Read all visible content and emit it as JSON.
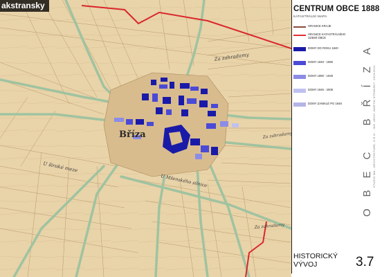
{
  "watermark": "akstransky",
  "panel": {
    "title": "CENTRUM OBCE 1888",
    "subtitle": "KATASTRÁLNÍ MAPA",
    "vertical_title": "OBEC BŘÍZA",
    "vertical_credit": "STUDIO MA - ARCHITEKTURE, S.R.O. - ING. ARCH. MARTIN STRÁNSKÝ, 2023/2024",
    "footer_label": "HISTORICKÝ\nVÝVOJ",
    "page_number": "3.7"
  },
  "legend": [
    {
      "label": "HRANICE KRAJE",
      "kind": "line",
      "color": "#8b4a3a"
    },
    {
      "label": "HRANICE KATASTRÁLNÍHO\nÚZEMÍ OBCE",
      "kind": "line",
      "color": "#e03030"
    },
    {
      "label": "DOMY DO ROKU 1840",
      "kind": "swatch",
      "color": "#1a1aa8"
    },
    {
      "label": "DOMY 1840 - 1890",
      "kind": "swatch",
      "color": "#4a4ad6"
    },
    {
      "label": "DOMY 1890 - 1949",
      "kind": "swatch",
      "color": "#8c8ce6"
    },
    {
      "label": "DOMY 1945 - 2008",
      "kind": "swatch",
      "color": "#c0c0f0"
    },
    {
      "label": "DOMY ZANIKLÉ PO 1948",
      "kind": "swatch",
      "color": "#b4b4e6"
    }
  ],
  "map_labels": {
    "village": "Bříza",
    "locality_1": "Za zahradamy",
    "locality_2": "Za zahradamy",
    "locality_3": "Za zahradamy",
    "locality_4": "U široké meze",
    "locality_5": "U Mšenského silnice"
  },
  "colors": {
    "paper": "#e9d3a9",
    "paper_dark": "#d6ba8a",
    "road": "#9fc3a0",
    "boundary": "#d9262b",
    "house_oldest": "#1a1aa8",
    "house_1890": "#4a4ad6"
  }
}
